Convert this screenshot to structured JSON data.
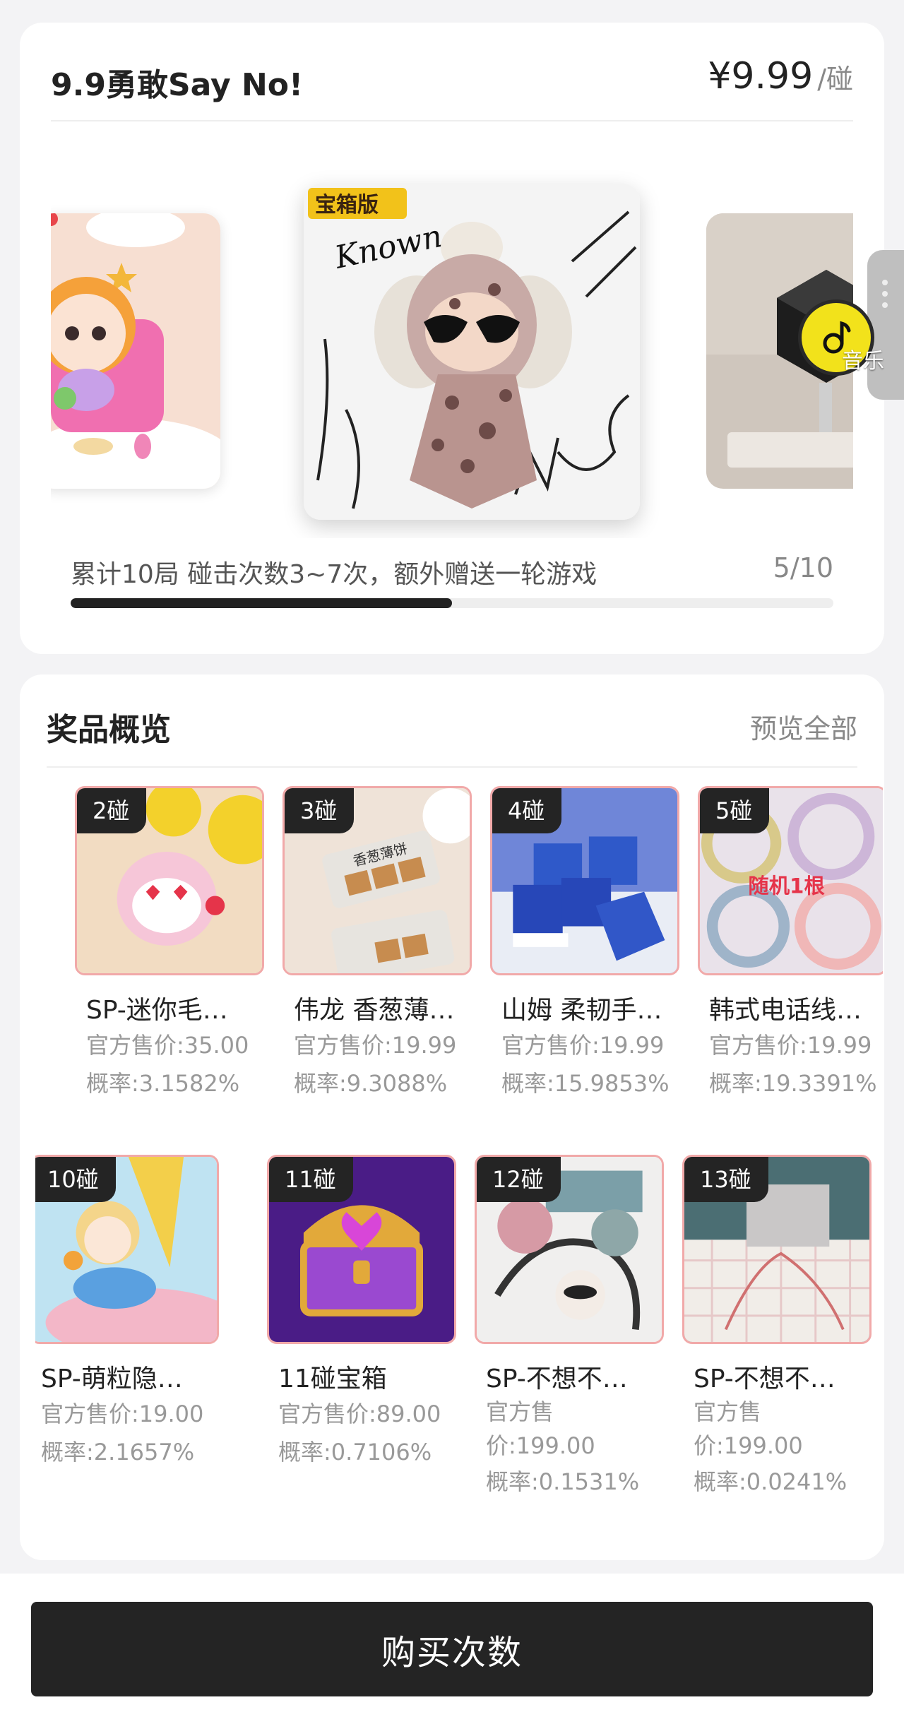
{
  "header": {
    "title": "9.9勇敢Say No!",
    "price_amount": "¥9.99",
    "price_unit": "/碰"
  },
  "carousel": {
    "center_badge": "宝箱版",
    "center_script": "Known"
  },
  "music": {
    "label": "音乐"
  },
  "progress": {
    "text": "累计10局 碰击次数3~7次，额外赠送一轮游戏",
    "count": "5/10",
    "fraction": 0.5
  },
  "prizes": {
    "title": "奖品概览",
    "preview_all": "预览全部",
    "items": [
      {
        "badge": "2碰",
        "name": "SP-迷你毛…",
        "price": "官方售价:35.00",
        "prob": "概率:3.1582%"
      },
      {
        "badge": "3碰",
        "name": "伟龙 香葱薄…",
        "price": "官方售价:19.99",
        "prob": "概率:9.3088%",
        "img_text": "香葱薄饼"
      },
      {
        "badge": "4碰",
        "name": "山姆 柔韧手…",
        "price": "官方售价:19.99",
        "prob": "概率:15.9853%"
      },
      {
        "badge": "5碰",
        "name": "韩式电话线…",
        "price": "官方售价:19.99",
        "prob": "概率:19.3391%",
        "img_text": "随机1根"
      },
      {
        "badge": "10碰",
        "name": "SP-萌粒隐…",
        "price": "官方售价:19.00",
        "prob": "概率:2.1657%"
      },
      {
        "badge": "11碰",
        "name": "11碰宝箱",
        "price": "官方售价:89.00",
        "prob": "概率:0.7106%"
      },
      {
        "badge": "12碰",
        "name": "SP-不想不…",
        "price": "官方售价:199.00",
        "prob": "概率:0.1531%"
      },
      {
        "badge": "13碰",
        "name": "SP-不想不…",
        "price": "官方售价:199.00",
        "prob": "概率:0.0241%"
      }
    ]
  },
  "buy_button": "购买次数"
}
